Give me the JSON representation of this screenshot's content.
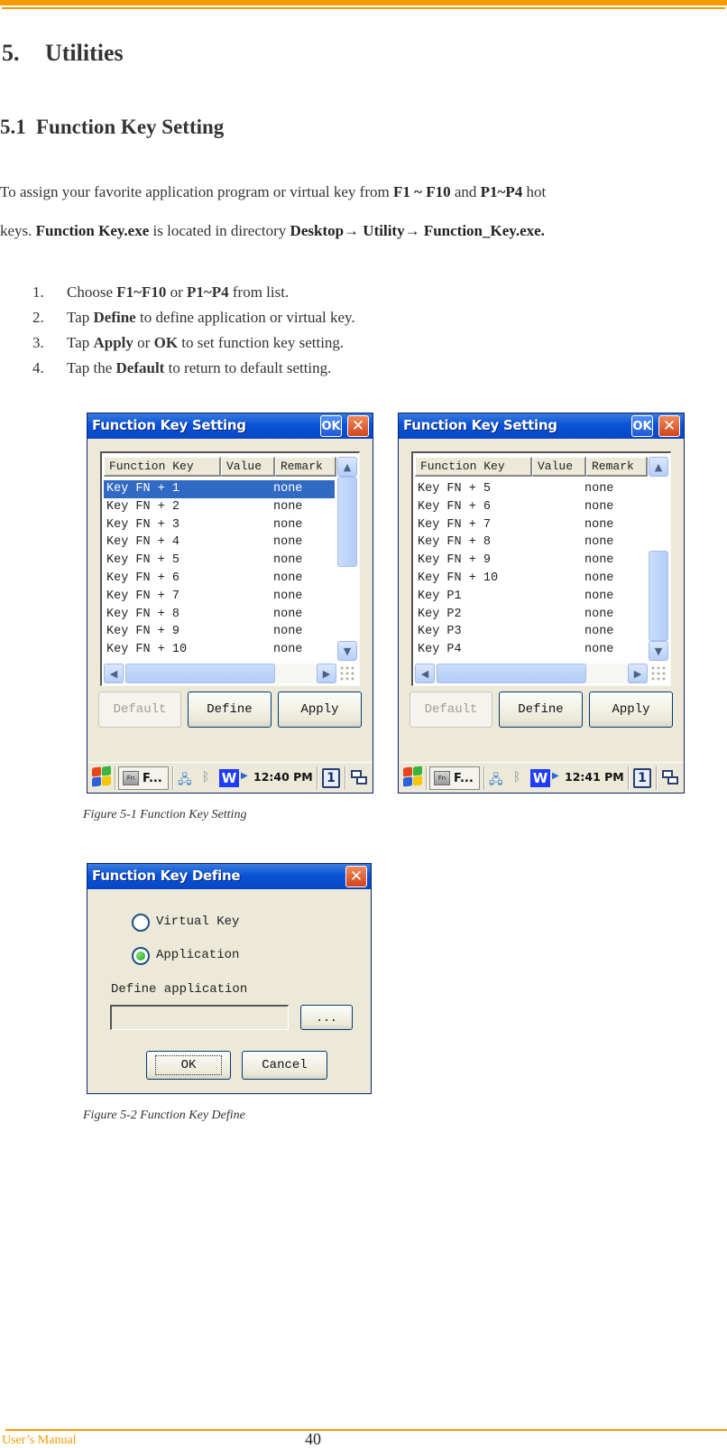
{
  "chapter": {
    "number": "5.",
    "title": "Utilities"
  },
  "section": {
    "number": "5.1",
    "title": "Function Key Setting"
  },
  "intro": {
    "line1": [
      {
        "t": "To assign your favorite application program or virtual key from ",
        "b": false
      },
      {
        "t": "F1 ~ F10",
        "b": true
      },
      {
        "t": " and  ",
        "b": false
      },
      {
        "t": "P1~P4",
        "b": true
      },
      {
        "t": " hot",
        "b": false
      }
    ],
    "line2": [
      {
        "t": "keys. ",
        "b": false
      },
      {
        "t": "Function Key.exe",
        "b": true
      },
      {
        "t": " is located in directory ",
        "b": false
      },
      {
        "t": "Desktop→ Utility→ Function_Key.exe.",
        "b": true
      }
    ]
  },
  "steps": [
    {
      "n": "1.",
      "parts": [
        {
          "t": "Choose ",
          "b": false
        },
        {
          "t": "F1~F10",
          "b": true
        },
        {
          "t": " or ",
          "b": false
        },
        {
          "t": "P1~P4",
          "b": true
        },
        {
          "t": " from list.",
          "b": false
        }
      ]
    },
    {
      "n": "2.",
      "parts": [
        {
          "t": "Tap ",
          "b": false
        },
        {
          "t": "Define",
          "b": true
        },
        {
          "t": " to define application or virtual key.",
          "b": false
        }
      ]
    },
    {
      "n": "3.",
      "parts": [
        {
          "t": "Tap ",
          "b": false
        },
        {
          "t": "Apply",
          "b": true
        },
        {
          "t": " or ",
          "b": false
        },
        {
          "t": "OK",
          "b": true
        },
        {
          "t": " to set function key setting.",
          "b": false
        }
      ]
    },
    {
      "n": "4.",
      "parts": [
        {
          "t": "Tap the ",
          "b": false
        },
        {
          "t": "Default",
          "b": true
        },
        {
          "t": " to return to default setting.",
          "b": false
        }
      ]
    }
  ],
  "setting_dialog": {
    "title": "Function Key Setting",
    "ok_label": "OK",
    "close_glyph": "✕",
    "columns": [
      "Function Key",
      "Value",
      "Remark"
    ],
    "buttons": {
      "default": "Default",
      "define": "Define",
      "apply": "Apply"
    },
    "taskbar": {
      "task_label": "F...",
      "fn_badge": "Fn",
      "w_label": "W",
      "desk_num": "1"
    }
  },
  "screens": [
    {
      "selected_index": 0,
      "rows": [
        {
          "key": "Key FN + 1",
          "remark": "none"
        },
        {
          "key": "Key FN + 2",
          "remark": "none"
        },
        {
          "key": "Key FN + 3",
          "remark": "none"
        },
        {
          "key": "Key FN + 4",
          "remark": "none"
        },
        {
          "key": "Key FN + 5",
          "remark": "none"
        },
        {
          "key": "Key FN + 6",
          "remark": "none"
        },
        {
          "key": "Key FN + 7",
          "remark": "none"
        },
        {
          "key": "Key FN + 8",
          "remark": "none"
        },
        {
          "key": "Key FN + 9",
          "remark": "none"
        },
        {
          "key": "Key FN + 10",
          "remark": "none"
        }
      ],
      "scroll_position": 0.0,
      "clock": "12:40 PM"
    },
    {
      "selected_index": -1,
      "rows": [
        {
          "key": "Key FN + 5",
          "remark": "none"
        },
        {
          "key": "Key FN + 6",
          "remark": "none"
        },
        {
          "key": "Key FN + 7",
          "remark": "none"
        },
        {
          "key": "Key FN + 8",
          "remark": "none"
        },
        {
          "key": "Key FN + 9",
          "remark": "none"
        },
        {
          "key": "Key FN + 10",
          "remark": "none"
        },
        {
          "key": "Key P1",
          "remark": "none"
        },
        {
          "key": "Key P2",
          "remark": "none"
        },
        {
          "key": "Key P3",
          "remark": "none"
        },
        {
          "key": "Key P4",
          "remark": "none"
        }
      ],
      "scroll_position": 1.0,
      "clock": "12:41 PM"
    }
  ],
  "figure1_caption": "Figure 5-1 Function Key Setting",
  "define_dialog": {
    "title": "Function Key Define",
    "close_glyph": "✕",
    "radio_virtual": "Virtual Key",
    "radio_application": "Application",
    "selected": "Application",
    "field_label": "Define application",
    "field_value": "",
    "browse_label": "...",
    "ok_label": "OK",
    "cancel_label": "Cancel"
  },
  "figure2_caption": "Figure 5-2 Function Key Define",
  "footer": {
    "left": "User’s Manual",
    "page": "40"
  },
  "colors": {
    "accent": "#f79a00",
    "titlebar": "#0a53d8",
    "selection": "#316ac5"
  }
}
